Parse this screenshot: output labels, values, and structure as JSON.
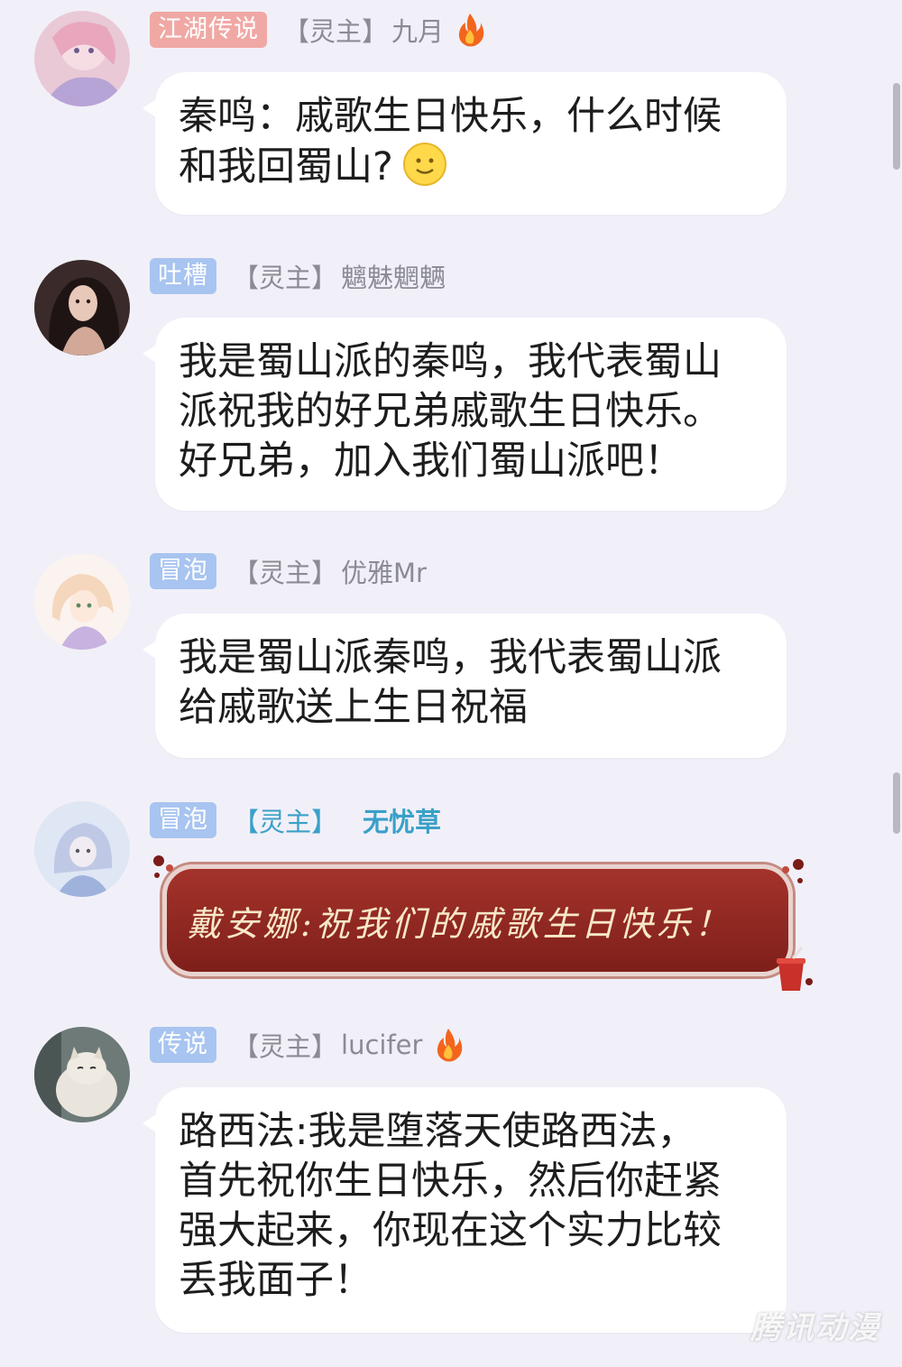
{
  "messages": [
    {
      "badge": "江湖传说",
      "role": "【灵主】",
      "username": "九月",
      "has_fire": true,
      "lines": [
        "秦鸣：戚歌生日快乐，什么时候",
        "和我回蜀山?"
      ],
      "emoji": "smile-emoji"
    },
    {
      "badge": "吐槽",
      "role": "【灵主】",
      "username": "魑魅魍魉",
      "has_fire": false,
      "lines": [
        "我是蜀山派的秦鸣，我代表蜀山",
        "派祝我的好兄弟戚歌生日快乐。",
        "好兄弟，加入我们蜀山派吧！"
      ]
    },
    {
      "badge": "冒泡",
      "role": "【灵主】",
      "username": "优雅Mr",
      "has_fire": false,
      "lines": [
        "我是蜀山派秦鸣，我代表蜀山派",
        "给戚歌送上生日祝福"
      ]
    },
    {
      "badge": "冒泡",
      "role": "【灵主】",
      "username": "无忧草",
      "has_fire": false,
      "fancy_text": "戴安娜:祝我们的戚歌生日快乐！"
    },
    {
      "badge": "传说",
      "role": "【灵主】",
      "username": "lucifer",
      "has_fire": true,
      "lines": [
        "路西法:我是堕落天使路西法，",
        "首先祝你生日快乐，然后你赶紧",
        "强大起来，你现在这个实力比较",
        "丢我面子！"
      ]
    }
  ],
  "watermark": "腾讯动漫",
  "colors": {
    "background": "#f1f0f8",
    "badge_red": "#f0a8a4",
    "badge_blue": "#a8c4f0",
    "teal_name": "#3aa0c8",
    "fancy_bubble": "#8e2822"
  }
}
